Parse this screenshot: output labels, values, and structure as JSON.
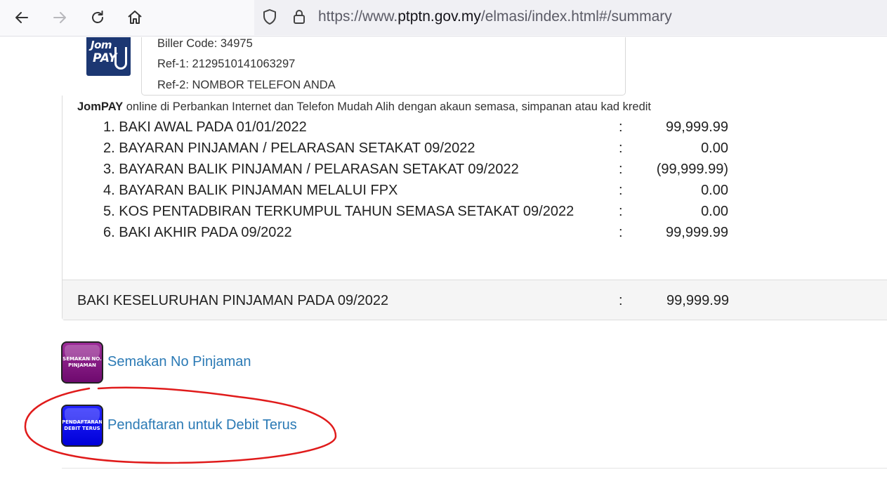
{
  "browser": {
    "url_prefix": "https://www.",
    "url_host": "ptptn.gov.my",
    "url_path": "/elmasi/index.html#/summary",
    "icons": [
      "back-arrow-icon",
      "forward-arrow-icon",
      "reload-icon",
      "home-icon",
      "shield-icon",
      "lock-icon"
    ]
  },
  "jompay": {
    "logo_line1": "Jom",
    "logo_line2": "PAY",
    "biller_code": "Biller Code: 34975",
    "ref1": "Ref-1: 2129510141063297",
    "ref2": "Ref-2: NOMBOR TELEFON ANDA",
    "desc_brand": "JomPAY",
    "desc_text": " online di Perbankan Internet dan Telefon Mudah Alih dengan akaun semasa, simpanan atau kad kredit"
  },
  "summary": {
    "items": [
      {
        "label": "1. BAKI AWAL PADA 01/01/2022",
        "colon": ":",
        "value": "99,999.99"
      },
      {
        "label": "2. BAYARAN PINJAMAN / PELARASAN SETAKAT 09/2022",
        "colon": ":",
        "value": "0.00"
      },
      {
        "label": "3. BAYARAN BALIK PINJAMAN / PELARASAN SETAKAT 09/2022",
        "colon": ":",
        "value": "(99,999.99)"
      },
      {
        "label": "4. BAYARAN BALIK PINJAMAN MELALUI FPX",
        "colon": ":",
        "value": "0.00"
      },
      {
        "label": "5. KOS PENTADBIRAN TERKUMPUL TAHUN SEMASA SETAKAT 09/2022",
        "colon": ":",
        "value": "0.00"
      },
      {
        "label": "6. BAKI AKHIR PADA 09/2022",
        "colon": ":",
        "value": "99,999.99"
      }
    ],
    "total_label": "BAKI KESELURUHAN PINJAMAN PADA 09/2022",
    "total_colon": ":",
    "total_value": "99,999.99"
  },
  "links": {
    "semakan_icon_text": "SEMAKAN NO. PINJAMAN",
    "semakan_label": "Semakan No Pinjaman",
    "debit_icon_text": "PENDAFTARAN DEBIT TERUS",
    "debit_label": "Pendaftaran untuk Debit Terus"
  },
  "colors": {
    "link": "#2b7ab5",
    "annotation_red": "#e01b1b",
    "semakan_button": "#8a1a87",
    "debit_button": "#0000ee",
    "jompay_logo": "#1c3772"
  }
}
